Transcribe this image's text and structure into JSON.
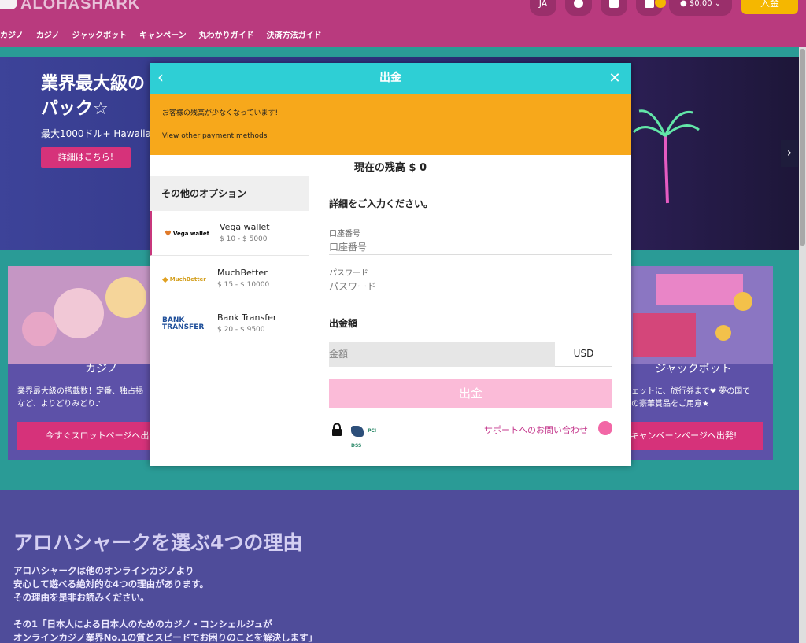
{
  "header": {
    "logo_text": "ALOHASHARK",
    "nav": [
      "カジノ",
      "カジノ",
      "ジャックポット",
      "キャンペーン",
      "丸わかりガイド",
      "決済方法ガイド"
    ],
    "lang_label": "JA",
    "balance_label": "$0.00",
    "deposit_label": "入金"
  },
  "hero": {
    "title": "業界最大級の\nパック☆",
    "subtitle": "最大1000ドル+ Hawaiian",
    "button_label": "詳細はこちら!"
  },
  "cards": [
    {
      "title": "カジノ",
      "text": "業界最大級の搭載数！定番、独占掲\nなど、よりどりみどり♪",
      "button_label": "今すぐスロットページへ出発"
    },
    {
      "title": "ジャックポット",
      "text": "ジェットに、旅行券まで❤ 夢の国で\nんの豪華賞品をご用意★",
      "button_label": "ぐキャンペーンページへ出発!"
    }
  ],
  "reasons": {
    "title": "アロハシャークを選ぶ4つの理由",
    "text": "アロハシャークは他のオンラインカジノより\n安心して遊べる絶対的な4つの理由があります。\nその理由を是非お読みください。\n\nその1「日本人による日本人のためのカジノ・コンシェルジュが\nオンラインカジノ業界No.1の質とスピードでお困りのことを解決します」"
  },
  "modal": {
    "title": "出金",
    "alert_text": "お客様の残高が少なくなっています!",
    "alert_link": "View other payment methods",
    "balance_text": "現在の残高 $ 0",
    "side_title": "その他のオプション",
    "options": [
      {
        "logo": "Vega wallet",
        "name": "Vega wallet",
        "range": "$ 10 - $ 5000"
      },
      {
        "logo": "MuchBetter",
        "name": "MuchBetter",
        "range": "$ 15 - $ 10000"
      },
      {
        "logo": "BANK TRANSFER",
        "name": "Bank Transfer",
        "range": "$ 20 - $ 9500"
      }
    ],
    "form_title": "詳細をご入力ください。",
    "account_label": "口座番号",
    "account_placeholder": "口座番号",
    "password_label": "パスワード",
    "password_placeholder": "パスワード",
    "amount_title": "出金額",
    "amount_placeholder": "金額",
    "currency": "USD",
    "submit_label": "出金",
    "pci_label": "PCI DSS",
    "support_link": "サポートへのお問い合わせ"
  },
  "colors": {
    "header": "#b93a7e",
    "modal_header": "#2ecfd5",
    "alert": "#f7a81b",
    "submit": "#fbbbd8",
    "accent": "#c8377c"
  }
}
